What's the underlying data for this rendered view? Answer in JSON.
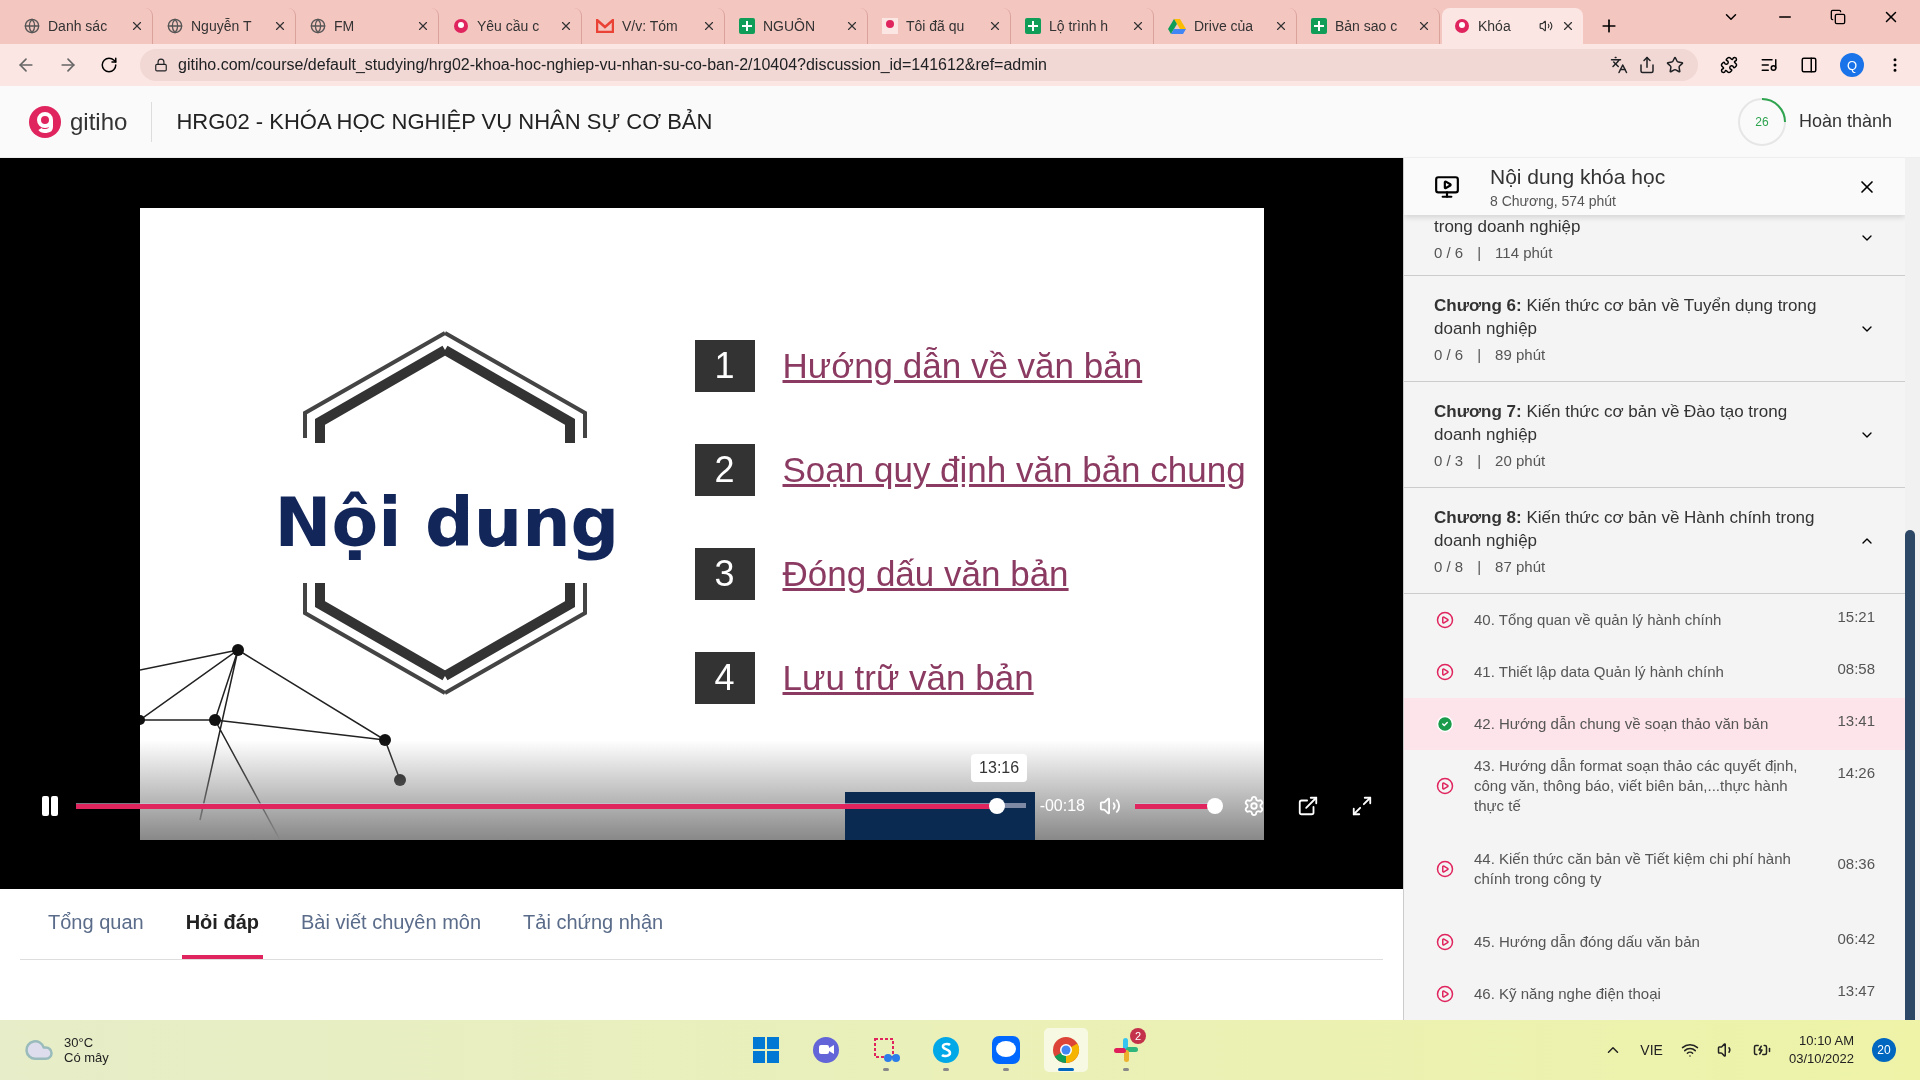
{
  "browser": {
    "tabs": [
      {
        "title": "Danh sác",
        "kind": "globe",
        "selected": false
      },
      {
        "title": "Nguyễn T",
        "kind": "globe",
        "selected": false
      },
      {
        "title": "FM",
        "kind": "globe",
        "selected": false
      },
      {
        "title": "Yêu cầu c",
        "kind": "gitiho",
        "selected": false
      },
      {
        "title": "V/v: Tóm",
        "kind": "gmail",
        "selected": false
      },
      {
        "title": "NGUỒN",
        "kind": "sheets",
        "selected": false
      },
      {
        "title": "Tôi đã qu",
        "kind": "image",
        "selected": false
      },
      {
        "title": "Lộ trình h",
        "kind": "sheets",
        "selected": false
      },
      {
        "title": "Drive của",
        "kind": "drive",
        "selected": false
      },
      {
        "title": "Bản sao c",
        "kind": "sheets",
        "selected": false
      },
      {
        "title": "Khóa",
        "kind": "gitiho",
        "selected": true
      }
    ],
    "url": "gitiho.com/course/default_studying/hrg02-khoa-hoc-nghiep-vu-nhan-su-co-ban-2/10404?discussion_id=141612&ref=admin",
    "profile": "Q"
  },
  "header": {
    "logo": "gitiho",
    "course_title": "HRG02 - KHÓA HỌC NGHIỆP VỤ NHÂN SỰ CƠ BẢN",
    "progress_count": "26",
    "status": "Hoàn thành"
  },
  "video": {
    "slide_title": "Nội dung",
    "slide_items": [
      {
        "number": "1",
        "text": "Hướng dẫn về văn bản"
      },
      {
        "number": "2",
        "text": "Soạn quy định văn bản chung"
      },
      {
        "number": "3",
        "text": "Đóng dấu văn bản"
      },
      {
        "number": "4",
        "text": "Lưu trữ văn bản"
      }
    ],
    "playing": true,
    "level": 0.97,
    "tooltip": "13:16",
    "remaining": "-00:18",
    "volume": {
      "level": 1
    }
  },
  "page_tabs": [
    {
      "label": "Tổng quan",
      "selected": false
    },
    {
      "label": "Hỏi đáp",
      "selected": true
    },
    {
      "label": "Bài viết chuyên môn",
      "selected": false
    },
    {
      "label": "Tải chứng nhận",
      "selected": false
    }
  ],
  "panel": {
    "title": "Nội dung khóa học",
    "subtitle": "8 Chương, 574 phút",
    "chapters": [
      {
        "title": "trong doanh nghiệp",
        "progress": "0 / 6",
        "separator": "|",
        "duration": "114 phút",
        "expanded": false
      },
      {
        "label": "Chương 6:",
        "title": "Kiến thức cơ bản về Tuyển dụng trong doanh nghiệp",
        "progress": "0 / 6",
        "separator": "|",
        "duration": "89 phút",
        "expanded": false
      },
      {
        "label": "Chương 7:",
        "title": "Kiến thức cơ bản về Đào tạo trong doanh nghiệp",
        "progress": "0 / 3",
        "separator": "|",
        "duration": "20 phút",
        "expanded": false
      },
      {
        "label": "Chương 8:",
        "title": "Kiến thức cơ bản về Hành chính trong doanh nghiệp",
        "progress": "0 / 8",
        "separator": "|",
        "duration": "87 phút",
        "expanded": true
      }
    ],
    "lessons": [
      {
        "title": "40. Tổng quan về quản lý hành chính",
        "duration": "15:21",
        "done": false,
        "selected": false
      },
      {
        "title": "41. Thiết lập data Quản lý hành chính",
        "duration": "08:58",
        "done": false,
        "selected": false
      },
      {
        "title": "42. Hướng dẫn chung về soạn thảo văn bản",
        "duration": "13:41",
        "done": true,
        "selected": true
      },
      {
        "title": "43. Hướng dẫn format soạn thảo các quyết định, công văn, thông báo, viết biên bản,...thực hành thực tế",
        "duration": "14:26",
        "done": false,
        "selected": false
      },
      {
        "title": "44. Kiến thức căn bản về Tiết kiệm chi phí hành chính trong công ty",
        "duration": "08:36",
        "done": false,
        "selected": false
      },
      {
        "title": "45. Hướng dẫn đóng dấu văn bản",
        "duration": "06:42",
        "done": false,
        "selected": false
      },
      {
        "title": "46. Kỹ năng nghe điện thoại",
        "duration": "13:47",
        "done": false,
        "selected": false
      }
    ]
  },
  "taskbar": {
    "temperature": "30°C",
    "condition": "Có mây",
    "apps": [
      {
        "kind": "start",
        "running": false,
        "selected": false
      },
      {
        "kind": "meet",
        "running": false,
        "selected": false
      },
      {
        "kind": "snip",
        "running": true,
        "selected": false
      },
      {
        "kind": "skype",
        "running": true,
        "selected": false
      },
      {
        "kind": "zalo",
        "running": true,
        "selected": false
      },
      {
        "kind": "chrome",
        "running": true,
        "selected": true
      },
      {
        "kind": "slack",
        "running": true,
        "selected": false,
        "badge": "2"
      }
    ],
    "language": "VIE",
    "time": "10:10 AM",
    "date": "03/10/2022",
    "notifications": "20"
  }
}
